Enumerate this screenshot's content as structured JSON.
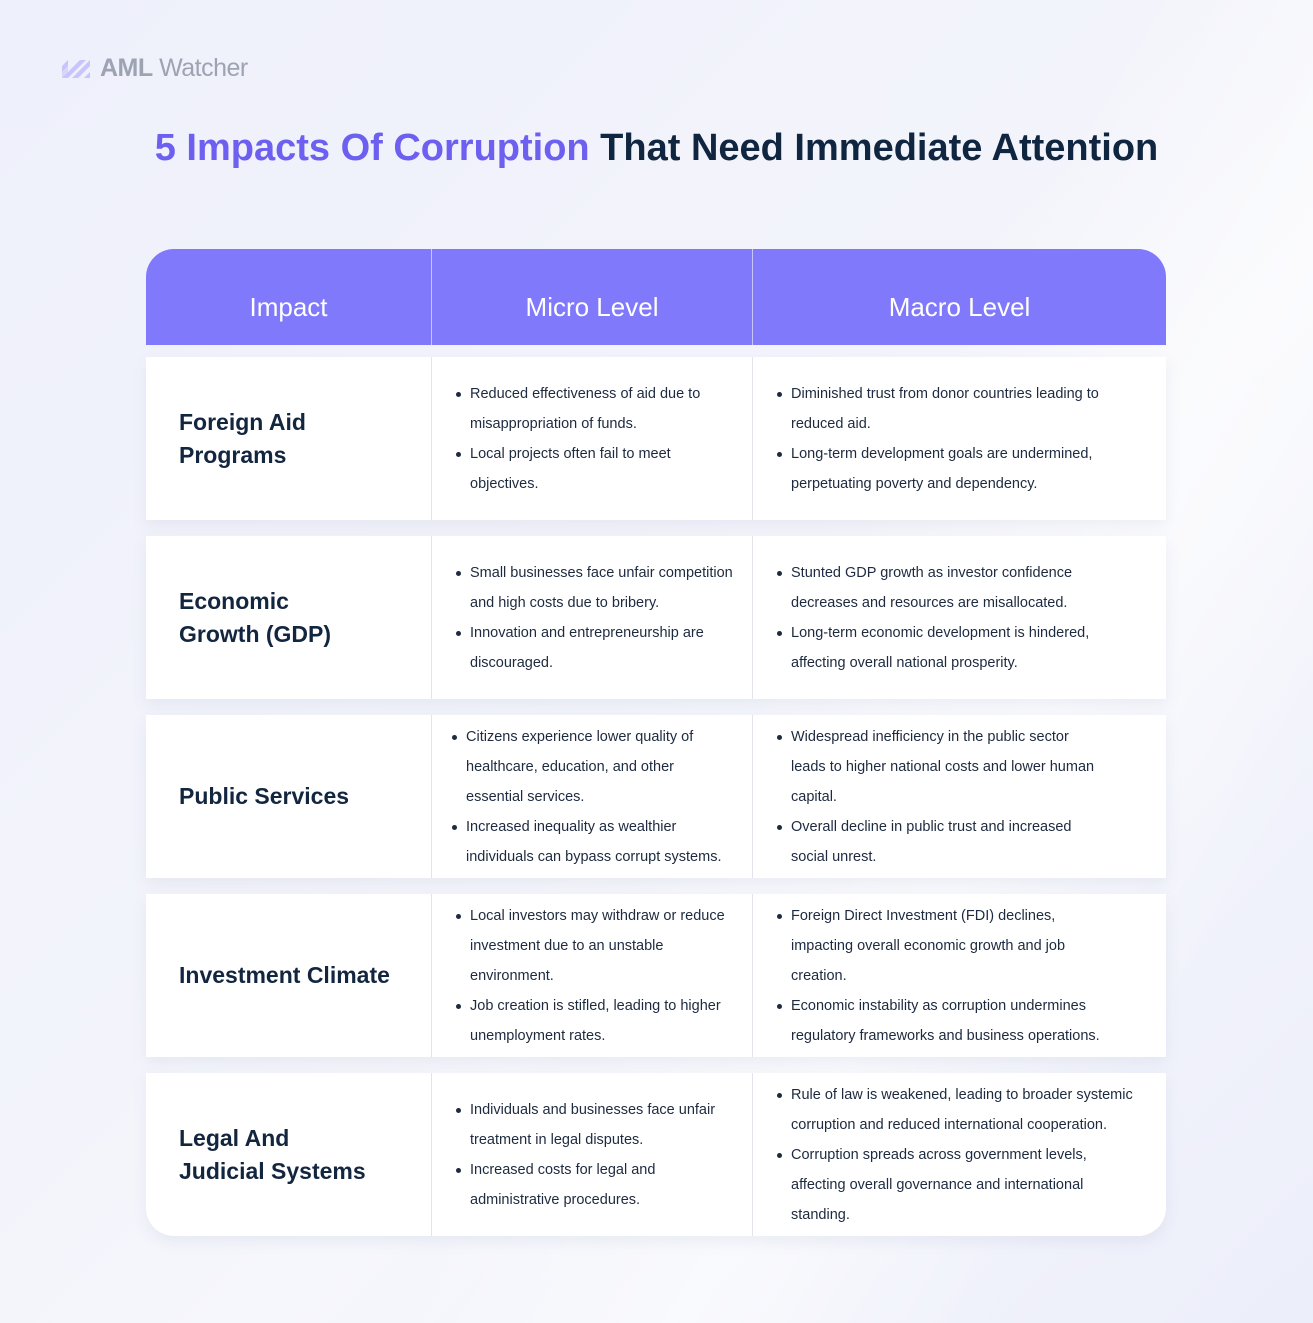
{
  "brand": {
    "name_strong": "AML",
    "name_light": "Watcher",
    "logo_icon": "striped-slash-logo-icon",
    "accent_color": "#6d5ff0",
    "header_color": "#8079fb"
  },
  "title": {
    "accent": "5 Impacts Of Corruption",
    "rest": " That Need Immediate Attention"
  },
  "table": {
    "headers": [
      "Impact",
      "Micro Level",
      "Macro Level"
    ],
    "rows": [
      {
        "impact": "Foreign Aid Programs",
        "micro": [
          "Reduced effectiveness of aid due to misappropriation of funds.",
          "Local projects often fail to meet objectives."
        ],
        "macro": [
          "Diminished trust from donor countries leading to reduced aid.",
          "Long-term development goals are undermined, perpetuating poverty and dependency."
        ]
      },
      {
        "impact": "Economic Growth (GDP)",
        "micro": [
          "Small businesses face unfair competition and high costs due to bribery.",
          "Innovation and entrepreneurship are discouraged."
        ],
        "macro": [
          "Stunted GDP growth as investor confidence decreases and resources are misallocated.",
          "Long-term economic development is hindered, affecting overall national prosperity."
        ]
      },
      {
        "impact": "Public Services",
        "micro": [
          "Citizens experience lower quality of healthcare, education, and other essential services.",
          "Increased inequality as wealthier individuals can bypass corrupt systems."
        ],
        "macro": [
          "Widespread inefficiency in the public sector leads to higher national costs and lower human capital.",
          "Overall decline in public trust and increased social unrest."
        ]
      },
      {
        "impact": "Investment Climate",
        "micro": [
          "Local investors may withdraw or reduce investment due to an unstable environment.",
          "Job creation is stifled, leading to higher unemployment rates."
        ],
        "macro": [
          "Foreign Direct Investment (FDI) declines, impacting overall economic growth and job creation.",
          "Economic instability as corruption undermines regulatory frameworks and business operations."
        ]
      },
      {
        "impact": "Legal And Judicial Systems",
        "micro": [
          "Individuals and businesses face unfair treatment in legal disputes.",
          "Increased costs for legal and administrative procedures."
        ],
        "macro": [
          "Rule of law is weakened, leading to broader systemic corruption and reduced international cooperation.",
          "Corruption spreads across government levels, affecting overall governance and international standing."
        ]
      }
    ]
  }
}
